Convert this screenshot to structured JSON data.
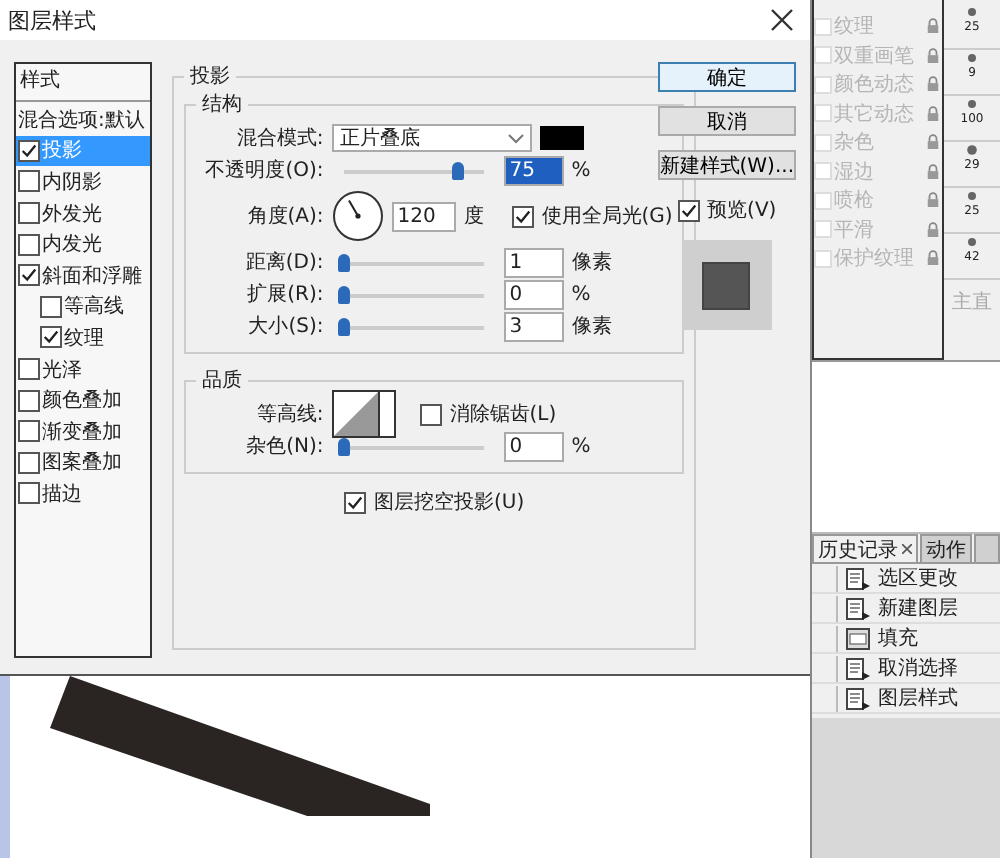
{
  "window": {
    "title": "图层样式"
  },
  "styles_list": {
    "header": "样式",
    "items": [
      {
        "label": "混合选项:默认",
        "kind": "option",
        "selected": false
      },
      {
        "label": "投影",
        "kind": "effect",
        "checked": true,
        "selected": true
      },
      {
        "label": "内阴影",
        "kind": "effect",
        "checked": false,
        "selected": false
      },
      {
        "label": "外发光",
        "kind": "effect",
        "checked": false,
        "selected": false
      },
      {
        "label": "内发光",
        "kind": "effect",
        "checked": false,
        "selected": false
      },
      {
        "label": "斜面和浮雕",
        "kind": "effect",
        "checked": true,
        "selected": false,
        "children": [
          {
            "label": "等高线",
            "kind": "effect",
            "checked": false,
            "selected": false
          },
          {
            "label": "纹理",
            "kind": "effect",
            "checked": true,
            "selected": false
          }
        ]
      },
      {
        "label": "光泽",
        "kind": "effect",
        "checked": false,
        "selected": false
      },
      {
        "label": "颜色叠加",
        "kind": "effect",
        "checked": false,
        "selected": false
      },
      {
        "label": "渐变叠加",
        "kind": "effect",
        "checked": false,
        "selected": false
      },
      {
        "label": "图案叠加",
        "kind": "effect",
        "checked": false,
        "selected": false
      },
      {
        "label": "描边",
        "kind": "effect",
        "checked": false,
        "selected": false
      }
    ]
  },
  "drop_shadow": {
    "title": "投影",
    "structure": {
      "title": "结构",
      "blend_mode": {
        "label": "混合模式:",
        "value": "正片叠底"
      },
      "opacity": {
        "label": "不透明度(O):",
        "level": 0.75,
        "value": "75",
        "unit": "%"
      },
      "angle": {
        "label": "角度(A):",
        "value": "120",
        "unit": "度"
      },
      "global_light": {
        "label": "使用全局光(G)",
        "checked": true
      },
      "sliders": [
        {
          "label": "距离(D):",
          "level": 0,
          "value": "1",
          "unit": "像素"
        },
        {
          "label": "扩展(R):",
          "level": 0,
          "value": "0",
          "unit": "%"
        },
        {
          "label": "大小(S):",
          "level": 0,
          "value": "3",
          "unit": "像素"
        }
      ]
    },
    "quality": {
      "title": "品质",
      "contour": {
        "label": "等高线:"
      },
      "anti_alias": {
        "label": "消除锯齿(L)",
        "checked": false
      },
      "noise": {
        "label": "杂色(N):",
        "level": 0,
        "value": "0",
        "unit": "%"
      }
    },
    "knockout": {
      "label": "图层挖空投影(U)",
      "checked": true
    }
  },
  "buttons": [
    {
      "label": "确定",
      "kind": "default"
    },
    {
      "label": "取消",
      "kind": "normal"
    },
    {
      "label": "新建样式(W)...",
      "kind": "normal"
    }
  ],
  "preview": {
    "label": "预览(V)",
    "checked": true
  },
  "brush_options": [
    {
      "label": "纹理",
      "checked": false,
      "disabled": true
    },
    {
      "label": "双重画笔",
      "checked": false,
      "disabled": true
    },
    {
      "label": "颜色动态",
      "checked": false,
      "disabled": true
    },
    {
      "label": "其它动态",
      "checked": false,
      "disabled": true
    },
    {
      "label": "杂色",
      "checked": false,
      "disabled": true
    },
    {
      "label": "湿边",
      "checked": false,
      "disabled": true
    },
    {
      "label": "喷枪",
      "checked": false,
      "disabled": true
    },
    {
      "label": "平滑",
      "checked": false,
      "disabled": true
    },
    {
      "label": "保护纹理",
      "checked": false,
      "disabled": true
    }
  ],
  "brush_presets": [
    "25",
    "9",
    "100",
    "29",
    "25",
    "42"
  ],
  "brush_size_label": "主直",
  "history": {
    "tabs": [
      {
        "label": "历史记录",
        "selected": true,
        "closable": true
      },
      {
        "label": "动作",
        "selected": false,
        "closable": false
      }
    ],
    "states": [
      {
        "label": "选区更改",
        "kind": "document"
      },
      {
        "label": "新建图层",
        "kind": "document"
      },
      {
        "label": "填充",
        "kind": "fill"
      },
      {
        "label": "取消选择",
        "kind": "document"
      },
      {
        "label": "图层样式",
        "kind": "document"
      }
    ]
  }
}
